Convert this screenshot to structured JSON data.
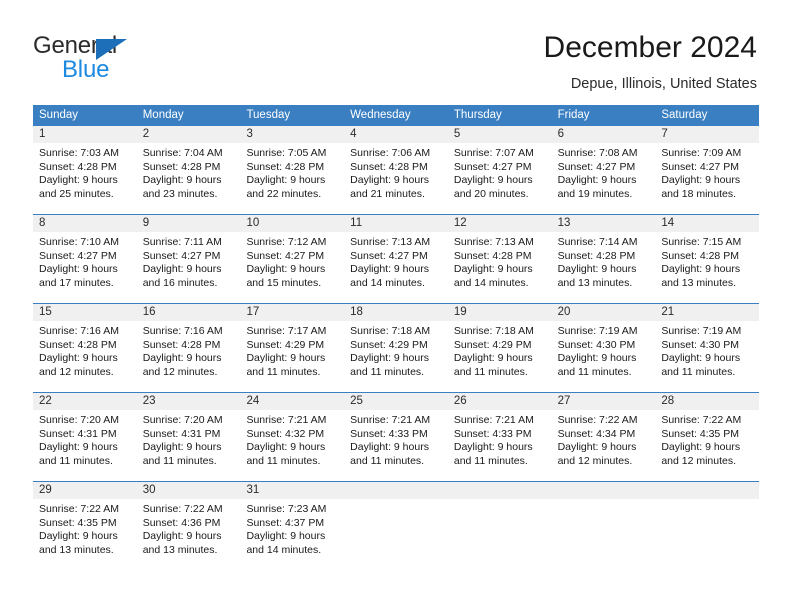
{
  "logo": {
    "primary_text": "General",
    "secondary_text": "Blue",
    "triangle_icon": "triangle-icon",
    "primary_color": "#2b2b2b",
    "secondary_color": "#1c8ae0",
    "triangle_color": "#1c6fb8"
  },
  "header": {
    "title": "December 2024",
    "subtitle": "Depue, Illinois, United States"
  },
  "theme": {
    "header_row_bg": "#3a7fc1",
    "day_number_bg": "#f0f0f0",
    "row_divider": "#3a7fc1",
    "text": "#1a1a1a"
  },
  "weekday_headers": [
    "Sunday",
    "Monday",
    "Tuesday",
    "Wednesday",
    "Thursday",
    "Friday",
    "Saturday"
  ],
  "weeks": [
    {
      "days": [
        {
          "number": "1",
          "sunrise": "Sunrise: 7:03 AM",
          "sunset": "Sunset: 4:28 PM",
          "daylight_line1": "Daylight: 9 hours",
          "daylight_line2": "and 25 minutes."
        },
        {
          "number": "2",
          "sunrise": "Sunrise: 7:04 AM",
          "sunset": "Sunset: 4:28 PM",
          "daylight_line1": "Daylight: 9 hours",
          "daylight_line2": "and 23 minutes."
        },
        {
          "number": "3",
          "sunrise": "Sunrise: 7:05 AM",
          "sunset": "Sunset: 4:28 PM",
          "daylight_line1": "Daylight: 9 hours",
          "daylight_line2": "and 22 minutes."
        },
        {
          "number": "4",
          "sunrise": "Sunrise: 7:06 AM",
          "sunset": "Sunset: 4:28 PM",
          "daylight_line1": "Daylight: 9 hours",
          "daylight_line2": "and 21 minutes."
        },
        {
          "number": "5",
          "sunrise": "Sunrise: 7:07 AM",
          "sunset": "Sunset: 4:27 PM",
          "daylight_line1": "Daylight: 9 hours",
          "daylight_line2": "and 20 minutes."
        },
        {
          "number": "6",
          "sunrise": "Sunrise: 7:08 AM",
          "sunset": "Sunset: 4:27 PM",
          "daylight_line1": "Daylight: 9 hours",
          "daylight_line2": "and 19 minutes."
        },
        {
          "number": "7",
          "sunrise": "Sunrise: 7:09 AM",
          "sunset": "Sunset: 4:27 PM",
          "daylight_line1": "Daylight: 9 hours",
          "daylight_line2": "and 18 minutes."
        }
      ]
    },
    {
      "days": [
        {
          "number": "8",
          "sunrise": "Sunrise: 7:10 AM",
          "sunset": "Sunset: 4:27 PM",
          "daylight_line1": "Daylight: 9 hours",
          "daylight_line2": "and 17 minutes."
        },
        {
          "number": "9",
          "sunrise": "Sunrise: 7:11 AM",
          "sunset": "Sunset: 4:27 PM",
          "daylight_line1": "Daylight: 9 hours",
          "daylight_line2": "and 16 minutes."
        },
        {
          "number": "10",
          "sunrise": "Sunrise: 7:12 AM",
          "sunset": "Sunset: 4:27 PM",
          "daylight_line1": "Daylight: 9 hours",
          "daylight_line2": "and 15 minutes."
        },
        {
          "number": "11",
          "sunrise": "Sunrise: 7:13 AM",
          "sunset": "Sunset: 4:27 PM",
          "daylight_line1": "Daylight: 9 hours",
          "daylight_line2": "and 14 minutes."
        },
        {
          "number": "12",
          "sunrise": "Sunrise: 7:13 AM",
          "sunset": "Sunset: 4:28 PM",
          "daylight_line1": "Daylight: 9 hours",
          "daylight_line2": "and 14 minutes."
        },
        {
          "number": "13",
          "sunrise": "Sunrise: 7:14 AM",
          "sunset": "Sunset: 4:28 PM",
          "daylight_line1": "Daylight: 9 hours",
          "daylight_line2": "and 13 minutes."
        },
        {
          "number": "14",
          "sunrise": "Sunrise: 7:15 AM",
          "sunset": "Sunset: 4:28 PM",
          "daylight_line1": "Daylight: 9 hours",
          "daylight_line2": "and 13 minutes."
        }
      ]
    },
    {
      "days": [
        {
          "number": "15",
          "sunrise": "Sunrise: 7:16 AM",
          "sunset": "Sunset: 4:28 PM",
          "daylight_line1": "Daylight: 9 hours",
          "daylight_line2": "and 12 minutes."
        },
        {
          "number": "16",
          "sunrise": "Sunrise: 7:16 AM",
          "sunset": "Sunset: 4:28 PM",
          "daylight_line1": "Daylight: 9 hours",
          "daylight_line2": "and 12 minutes."
        },
        {
          "number": "17",
          "sunrise": "Sunrise: 7:17 AM",
          "sunset": "Sunset: 4:29 PM",
          "daylight_line1": "Daylight: 9 hours",
          "daylight_line2": "and 11 minutes."
        },
        {
          "number": "18",
          "sunrise": "Sunrise: 7:18 AM",
          "sunset": "Sunset: 4:29 PM",
          "daylight_line1": "Daylight: 9 hours",
          "daylight_line2": "and 11 minutes."
        },
        {
          "number": "19",
          "sunrise": "Sunrise: 7:18 AM",
          "sunset": "Sunset: 4:29 PM",
          "daylight_line1": "Daylight: 9 hours",
          "daylight_line2": "and 11 minutes."
        },
        {
          "number": "20",
          "sunrise": "Sunrise: 7:19 AM",
          "sunset": "Sunset: 4:30 PM",
          "daylight_line1": "Daylight: 9 hours",
          "daylight_line2": "and 11 minutes."
        },
        {
          "number": "21",
          "sunrise": "Sunrise: 7:19 AM",
          "sunset": "Sunset: 4:30 PM",
          "daylight_line1": "Daylight: 9 hours",
          "daylight_line2": "and 11 minutes."
        }
      ]
    },
    {
      "days": [
        {
          "number": "22",
          "sunrise": "Sunrise: 7:20 AM",
          "sunset": "Sunset: 4:31 PM",
          "daylight_line1": "Daylight: 9 hours",
          "daylight_line2": "and 11 minutes."
        },
        {
          "number": "23",
          "sunrise": "Sunrise: 7:20 AM",
          "sunset": "Sunset: 4:31 PM",
          "daylight_line1": "Daylight: 9 hours",
          "daylight_line2": "and 11 minutes."
        },
        {
          "number": "24",
          "sunrise": "Sunrise: 7:21 AM",
          "sunset": "Sunset: 4:32 PM",
          "daylight_line1": "Daylight: 9 hours",
          "daylight_line2": "and 11 minutes."
        },
        {
          "number": "25",
          "sunrise": "Sunrise: 7:21 AM",
          "sunset": "Sunset: 4:33 PM",
          "daylight_line1": "Daylight: 9 hours",
          "daylight_line2": "and 11 minutes."
        },
        {
          "number": "26",
          "sunrise": "Sunrise: 7:21 AM",
          "sunset": "Sunset: 4:33 PM",
          "daylight_line1": "Daylight: 9 hours",
          "daylight_line2": "and 11 minutes."
        },
        {
          "number": "27",
          "sunrise": "Sunrise: 7:22 AM",
          "sunset": "Sunset: 4:34 PM",
          "daylight_line1": "Daylight: 9 hours",
          "daylight_line2": "and 12 minutes."
        },
        {
          "number": "28",
          "sunrise": "Sunrise: 7:22 AM",
          "sunset": "Sunset: 4:35 PM",
          "daylight_line1": "Daylight: 9 hours",
          "daylight_line2": "and 12 minutes."
        }
      ]
    },
    {
      "days": [
        {
          "number": "29",
          "sunrise": "Sunrise: 7:22 AM",
          "sunset": "Sunset: 4:35 PM",
          "daylight_line1": "Daylight: 9 hours",
          "daylight_line2": "and 13 minutes."
        },
        {
          "number": "30",
          "sunrise": "Sunrise: 7:22 AM",
          "sunset": "Sunset: 4:36 PM",
          "daylight_line1": "Daylight: 9 hours",
          "daylight_line2": "and 13 minutes."
        },
        {
          "number": "31",
          "sunrise": "Sunrise: 7:23 AM",
          "sunset": "Sunset: 4:37 PM",
          "daylight_line1": "Daylight: 9 hours",
          "daylight_line2": "and 14 minutes."
        },
        {
          "number": "",
          "sunrise": "",
          "sunset": "",
          "daylight_line1": "",
          "daylight_line2": ""
        },
        {
          "number": "",
          "sunrise": "",
          "sunset": "",
          "daylight_line1": "",
          "daylight_line2": ""
        },
        {
          "number": "",
          "sunrise": "",
          "sunset": "",
          "daylight_line1": "",
          "daylight_line2": ""
        },
        {
          "number": "",
          "sunrise": "",
          "sunset": "",
          "daylight_line1": "",
          "daylight_line2": ""
        }
      ]
    }
  ]
}
